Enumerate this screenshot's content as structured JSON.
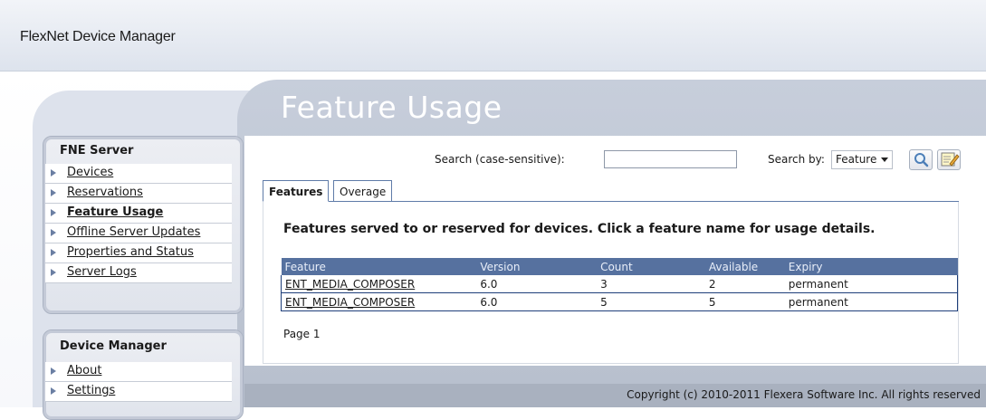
{
  "app": {
    "title": "FlexNet Device Manager"
  },
  "page": {
    "title": "Feature Usage"
  },
  "sidebar": {
    "fne_server": {
      "heading": "FNE Server",
      "items": [
        {
          "label": "Devices",
          "active": false
        },
        {
          "label": "Reservations",
          "active": false
        },
        {
          "label": "Feature Usage",
          "active": true
        },
        {
          "label": "Offline Server Updates",
          "active": false
        },
        {
          "label": "Properties and Status",
          "active": false
        },
        {
          "label": "Server Logs",
          "active": false
        }
      ]
    },
    "device_manager": {
      "heading": "Device Manager",
      "items": [
        {
          "label": "About",
          "active": false
        },
        {
          "label": "Settings",
          "active": false
        }
      ]
    }
  },
  "search": {
    "label": "Search (case-sensitive):",
    "value": "",
    "by_label": "Search by:",
    "by_value": "Feature",
    "search_icon": "magnifier-icon",
    "edit_icon": "edit-note-icon"
  },
  "tabs": [
    {
      "label": "Features",
      "active": true
    },
    {
      "label": "Overage",
      "active": false
    }
  ],
  "main": {
    "description": "Features served to or reserved for devices. Click a feature name for usage details.",
    "table": {
      "headers": [
        "Feature",
        "Version",
        "Count",
        "Available",
        "Expiry"
      ],
      "rows": [
        [
          "ENT_MEDIA_COMPOSER",
          "6.0",
          "3",
          "2",
          "permanent"
        ],
        [
          "ENT_MEDIA_COMPOSER",
          "6.0",
          "5",
          "5",
          "permanent"
        ]
      ]
    },
    "pager": "Page 1"
  },
  "footer": {
    "copyright": "Copyright (c) 2010-2011 Flexera Software Inc. All rights reserved"
  },
  "colors": {
    "table_header": "#56719f",
    "panel": "#c7cedb",
    "footer": "#a9b1bf"
  }
}
